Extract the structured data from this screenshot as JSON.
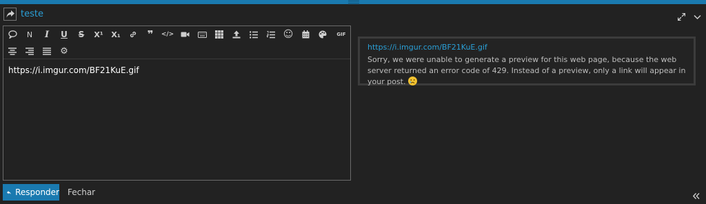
{
  "header": {
    "title": "teste"
  },
  "toolbar": {
    "buttons": [
      {
        "name": "speech-bubble-icon",
        "glyph": ""
      },
      {
        "name": "format-normal-icon",
        "glyph": "N"
      },
      {
        "name": "italic-icon",
        "glyph": "I"
      },
      {
        "name": "underline-icon",
        "glyph": "U"
      },
      {
        "name": "strikethrough-icon",
        "glyph": "S"
      },
      {
        "name": "superscript-icon",
        "glyph": "X¹"
      },
      {
        "name": "subscript-icon",
        "glyph": "X₁"
      },
      {
        "name": "link-icon",
        "glyph": ""
      },
      {
        "name": "quote-icon",
        "glyph": "❞"
      },
      {
        "name": "code-icon",
        "glyph": "</>"
      },
      {
        "name": "video-icon",
        "glyph": ""
      },
      {
        "name": "keyboard-icon",
        "glyph": ""
      },
      {
        "name": "table-icon",
        "glyph": ""
      },
      {
        "name": "upload-icon",
        "glyph": ""
      },
      {
        "name": "bulleted-list-icon",
        "glyph": ""
      },
      {
        "name": "numbered-list-icon",
        "glyph": ""
      },
      {
        "name": "emoji-icon",
        "glyph": "☺"
      },
      {
        "name": "calendar-icon",
        "glyph": ""
      },
      {
        "name": "palette-icon",
        "glyph": ""
      },
      {
        "name": "gif-icon",
        "glyph": "GIF"
      },
      {
        "name": "align-center-icon",
        "glyph": ""
      },
      {
        "name": "align-right-icon",
        "glyph": ""
      },
      {
        "name": "justify-icon",
        "glyph": ""
      },
      {
        "name": "settings-gear-icon",
        "glyph": "⚙"
      }
    ]
  },
  "editor": {
    "content": "https://i.imgur.com/BF21KuE.gif"
  },
  "preview": {
    "link": "https://i.imgur.com/BF21KuE.gif",
    "message": "Sorry, we were unable to generate a preview for this web page, because the web server returned an error code of 429. Instead of a preview, only a link will appear in your post."
  },
  "footer": {
    "reply_label": "Responder",
    "close_label": "Fechar"
  },
  "colors": {
    "accent": "#1a7ab0",
    "link": "#2a9fd6",
    "background": "#222222"
  }
}
